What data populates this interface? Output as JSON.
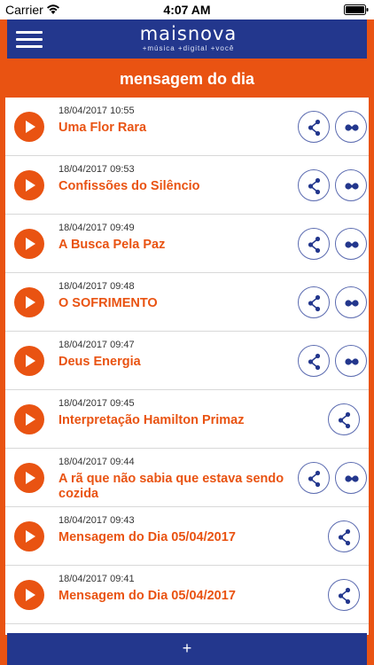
{
  "status_bar": {
    "carrier": "Carrier",
    "time": "4:07 AM"
  },
  "header": {
    "logo_name": "maisnova",
    "logo_tagline": "+música +digital +você"
  },
  "page": {
    "title": "mensagem do dia"
  },
  "items": [
    {
      "date": "18/04/2017 10:55",
      "title": "Uma Flor Rara"
    },
    {
      "date": "18/04/2017 09:53",
      "title": "Confissões do Silêncio"
    },
    {
      "date": "18/04/2017 09:49",
      "title": "A Busca Pela Paz"
    },
    {
      "date": "18/04/2017 09:48",
      "title": "O SOFRIMENTO"
    },
    {
      "date": "18/04/2017 09:47",
      "title": "Deus Energia"
    },
    {
      "date": "18/04/2017 09:45",
      "title": "Interpretação Hamilton Primaz"
    },
    {
      "date": "18/04/2017 09:44",
      "title": "A rã que não sabia que estava sendo cozida"
    },
    {
      "date": "18/04/2017 09:43",
      "title": "Mensagem do Dia 05/04/2017"
    },
    {
      "date": "18/04/2017 09:41",
      "title": "Mensagem do Dia 05/04/2017"
    }
  ],
  "bottom_bar": {
    "label": "+"
  },
  "icons": {
    "menu": "hamburger-icon",
    "play": "play-icon",
    "share": "share-icon",
    "more": "dots-icon",
    "wifi": "wifi-icon",
    "battery": "battery-icon"
  },
  "colors": {
    "accent_orange": "#e95312",
    "brand_navy": "#23378d",
    "button_outline": "#5b6bb0"
  }
}
